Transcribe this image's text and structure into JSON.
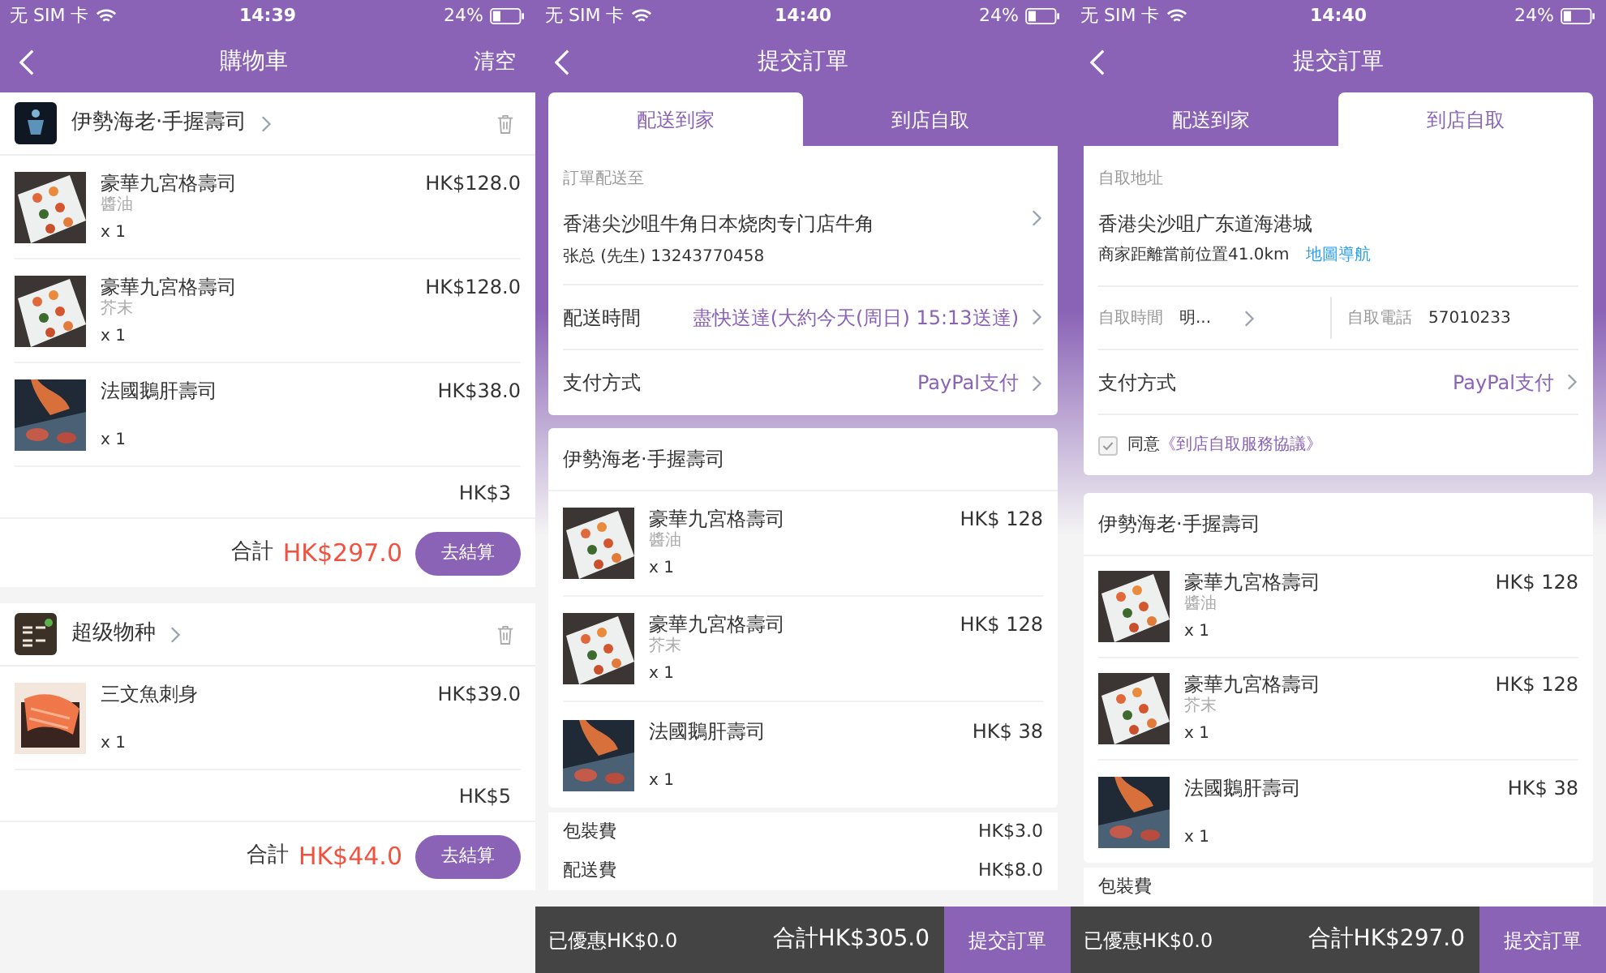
{
  "screens": [
    {
      "kind": "cart",
      "status": {
        "carrier": "无 SIM 卡",
        "time": "14:39",
        "battery": "24%"
      },
      "title": "購物車",
      "action": "清空",
      "stores": [
        {
          "name": "伊勢海老·手握壽司",
          "items": [
            {
              "name": "豪華九宮格壽司",
              "option": "醬油",
              "qty": "x 1",
              "price": "HK$128.0"
            },
            {
              "name": "豪華九宮格壽司",
              "option": "芥末",
              "qty": "x 1",
              "price": "HK$128.0"
            },
            {
              "name": "法國鵝肝壽司",
              "qty": "x 1",
              "price": "HK$38.0"
            }
          ],
          "fee": "HK$3",
          "total_label": "合計",
          "total": "HK$297.0",
          "checkout": "去結算"
        },
        {
          "name": "超级物种",
          "items": [
            {
              "name": "三文魚刺身",
              "qty": "x 1",
              "price": "HK$39.0"
            }
          ],
          "fee": "HK$5",
          "total_label": "合計",
          "total": "HK$44.0",
          "checkout": "去結算"
        }
      ]
    },
    {
      "kind": "checkout",
      "status": {
        "carrier": "无 SIM 卡",
        "time": "14:40",
        "battery": "24%"
      },
      "title": "提交訂單",
      "tabs": [
        {
          "label": "配送到家",
          "selected": true
        },
        {
          "label": "到店自取",
          "selected": false
        }
      ],
      "card": {
        "kind": "delivery",
        "label": "訂單配送至",
        "address": "香港尖沙咀牛角日本烧肉专门店牛角",
        "contact": "张总 (先生) 13243770458",
        "rows": [
          {
            "label": "配送時間",
            "value": "盡快送達(大約今天(周日) 15:13送達)"
          },
          {
            "label": "支付方式",
            "value": "PayPal支付"
          }
        ]
      },
      "order": {
        "store": "伊勢海老·手握壽司",
        "items": [
          {
            "name": "豪華九宮格壽司",
            "option": "醬油",
            "qty": "x 1",
            "price": "HK$ 128"
          },
          {
            "name": "豪華九宮格壽司",
            "option": "芥末",
            "qty": "x 1",
            "price": "HK$ 128"
          },
          {
            "name": "法國鵝肝壽司",
            "qty": "x 1",
            "price": "HK$ 38"
          }
        ],
        "fees": [
          {
            "label": "包裝費",
            "value": "HK$3.0"
          },
          {
            "label": "配送費",
            "value": "HK$8.0"
          }
        ]
      },
      "bar": {
        "discount": "已優惠HK$0.0",
        "total": "合計HK$305.0",
        "submit": "提交訂單"
      }
    },
    {
      "kind": "checkout",
      "status": {
        "carrier": "无 SIM 卡",
        "time": "14:40",
        "battery": "24%"
      },
      "title": "提交訂單",
      "tabs": [
        {
          "label": "配送到家",
          "selected": false
        },
        {
          "label": "到店自取",
          "selected": true
        }
      ],
      "card": {
        "kind": "pickup",
        "label": "自取地址",
        "address": "香港尖沙咀广东道海港城",
        "distance": "商家距離當前位置41.0km",
        "map_link": "地圖導航",
        "pickup_time": {
          "label": "自取時間",
          "value": "明..."
        },
        "phone": {
          "label": "自取電話",
          "value": "57010233"
        },
        "payment": {
          "label": "支付方式",
          "value": "PayPal支付"
        },
        "agree": {
          "checked": true,
          "text": "同意",
          "link": "《到店自取服務協議》"
        }
      },
      "order": {
        "store": "伊勢海老·手握壽司",
        "items": [
          {
            "name": "豪華九宮格壽司",
            "option": "醬油",
            "qty": "x 1",
            "price": "HK$ 128"
          },
          {
            "name": "豪華九宮格壽司",
            "option": "芥末",
            "qty": "x 1",
            "price": "HK$ 128"
          },
          {
            "name": "法國鵝肝壽司",
            "qty": "x 1",
            "price": "HK$ 38"
          }
        ],
        "fees": [
          {
            "label": "包裝費"
          }
        ]
      },
      "bar": {
        "discount": "已優惠HK$0.0",
        "total": "合計HK$297.0",
        "submit": "提交訂單"
      }
    }
  ]
}
